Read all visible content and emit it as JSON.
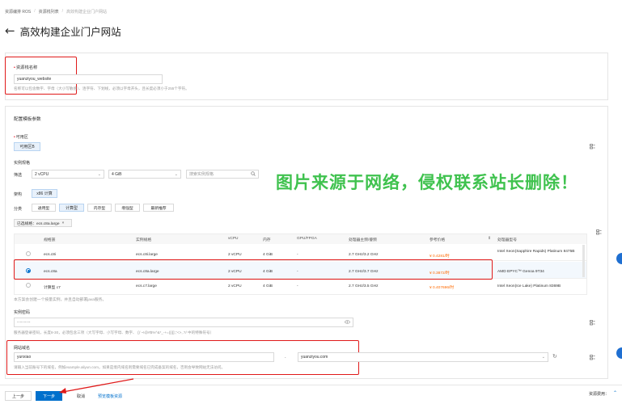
{
  "breadcrumb": [
    "资源编排 ROS",
    "资源栈列表",
    "高效构建企业门户网站"
  ],
  "page_title": "高效构建企业门户网站",
  "stack_name": {
    "label": "资源栈名称",
    "value": "yuanziyou_website",
    "hint": "名称可以包含数字、字母（大小写敏感）、连字符、下划线，必须以字母开头，且长度必须小于255个字符。"
  },
  "template_params": {
    "section_title": "配置模板参数",
    "zone": {
      "label": "可用区",
      "value": "可用区B"
    },
    "spec": {
      "label": "实例规格",
      "filter_label": "筛选",
      "vcpu": "2 vCPU",
      "memory": "4 GiB",
      "search_placeholder": "搜索实例规格",
      "arch_label": "架构",
      "arch_value": "x86 计算",
      "category_label": "分类",
      "categories": [
        "通用型",
        "计算型",
        "内存型",
        "增强型",
        "最新推荐"
      ],
      "active_category": "计算型",
      "selected_chip": "已选规格：ecs.c8a.large",
      "columns": [
        "规格族",
        "实例规格",
        "vCPU",
        "内存",
        "GPU/FPGA",
        "处理器主频/睿频",
        "参考价格",
        "处理器型号"
      ],
      "rows": [
        {
          "family": "ecs.c8i",
          "spec": "ecs.c8i.large",
          "vcpu": "2 vCPU",
          "mem": "4 GiB",
          "gpu": "-",
          "freq": "2.7 GHz/3.2 GHz",
          "price": "¥ 0.4281/时",
          "cpu": "Intel Xeon(Sapphire Rapids) Platinum 8475B",
          "selected": false
        },
        {
          "family": "ecs.c8a",
          "spec": "ecs.c8a.large",
          "vcpu": "2 vCPU",
          "mem": "4 GiB",
          "gpu": "-",
          "freq": "2.7 GHz/3.7 GHz",
          "price": "¥ 0.3872/时",
          "cpu": "AMD EPYC™ Genoa 9T34",
          "selected": true
        },
        {
          "family": "计算型 c7",
          "spec": "ecs.c7.large",
          "vcpu": "2 vCPU",
          "mem": "4 GiB",
          "gpu": "-",
          "freq": "2.7 GHz/3.5 GHz",
          "price": "¥ 0.407696/时",
          "cpu": "Intel Xeon(Ice Lake) Platinum 8369B",
          "selected": false
        }
      ],
      "note": "本方案会创建一个按量实例，并且自动部署java服务。"
    },
    "password": {
      "label": "实例密码",
      "value": "··········",
      "hint": "服务器登录密码，长度8-30，必须包含三项（大写字母、小写字母、数字、 ()`~!@#$%^&*_-+=|{}[]:;'<>,.?/ 中的特殊符号）"
    },
    "domain": {
      "label": "网站域名",
      "prefix": "yunxiao",
      "dot": ".",
      "suffix": "yuanziyou.com",
      "hint": "请输入当前账号下的域名，例如example.aliyun.com，如果是境内域名则需要域名已完成备案的域名，否则会导致网站无法访问。"
    }
  },
  "watermark": "图片来源于网络，侵权联系站长删除！",
  "footer": {
    "prev": "上一步",
    "next": "下一步",
    "cancel": "取消",
    "preview": "预览模板资源",
    "fee_label": "资源费用："
  },
  "colors": {
    "accent": "#0070cc",
    "price": "#ff6a00",
    "highlight": "#e01a1a",
    "watermark": "#3fc24e"
  }
}
